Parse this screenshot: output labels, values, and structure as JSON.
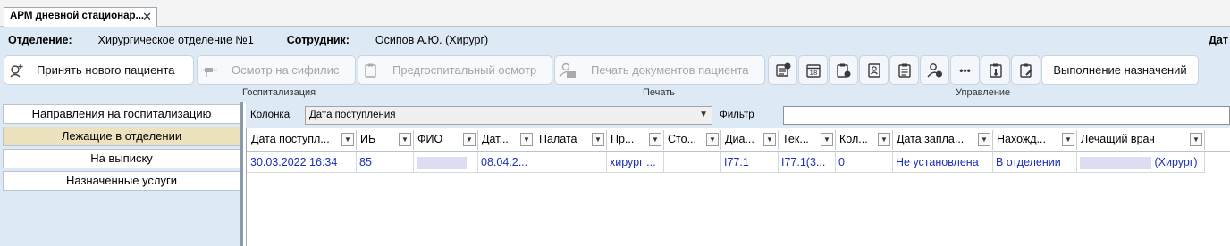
{
  "tab": {
    "title": "АРМ дневной стационар...",
    "close": "✕"
  },
  "info": {
    "department_label": "Отделение:",
    "department_value": "Хирургическое отделение №1",
    "employee_label": "Сотрудник:",
    "employee_value": "Осипов А.Ю. (Хирург)",
    "date_label": "Дат"
  },
  "toolbar": {
    "admit_new_patient": "Принять нового пациента",
    "syphilis_exam": "Осмотр на сифилис",
    "prehospital_exam": "Предгоспитальный осмотр",
    "print_patient_docs": "Печать документов пациента",
    "execution_assignments": "Выполнение назначений",
    "more": "•••"
  },
  "groups": {
    "hospitalization": "Госпитализация",
    "print": "Печать",
    "management": "Управление"
  },
  "left_menu": [
    {
      "label": "Направления на госпитализацию"
    },
    {
      "label": "Лежащие в отделении"
    },
    {
      "label": "На выписку"
    },
    {
      "label": "Назначенные услуги"
    }
  ],
  "filter": {
    "column_label": "Колонка",
    "column_value": "Дата поступления",
    "filter_label": "Фильтр",
    "filter_value": ""
  },
  "grid": {
    "headers": [
      "Дата поступл...",
      "ИБ",
      "ФИО",
      "Дат...",
      "Палата",
      "Пр...",
      "Сто...",
      "Диа...",
      "Тек...",
      "Кол...",
      "Дата запла...",
      "Нахожд...",
      "Лечащий врач"
    ],
    "row": {
      "admission_date": "30.03.2022 16:34",
      "ib": "85",
      "fio": "",
      "date2": "08.04.2...",
      "ward": "",
      "profile": "хирург ...",
      "cost": "",
      "diagnosis": "I77.1",
      "current": "I77.1(3...",
      "count": "0",
      "planned_date": "Не установлена",
      "location": "В отделении",
      "doctor_suffix": "(Хирург)"
    }
  }
}
